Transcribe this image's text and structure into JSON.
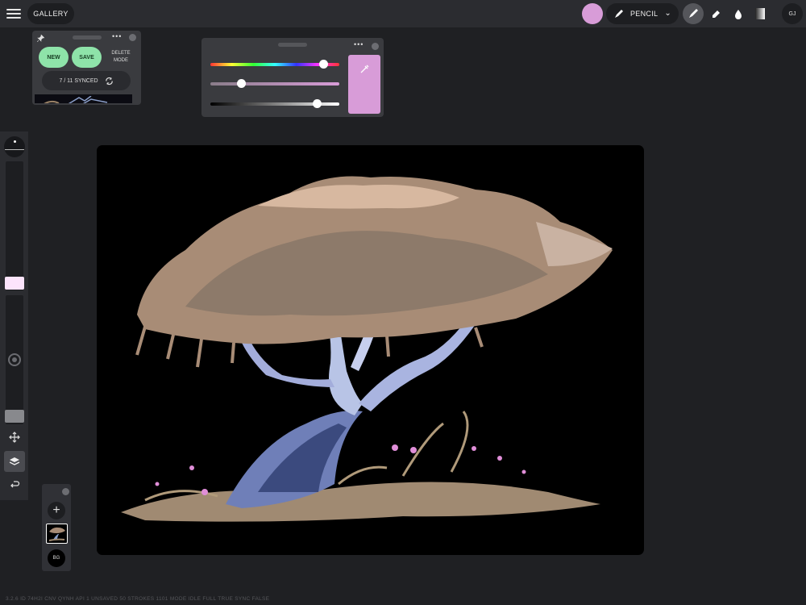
{
  "topbar": {
    "menu_icon": "hamburger-icon",
    "gallery_label": "GALLERY",
    "current_color": "#d89cd8",
    "brush_name": "PENCIL",
    "brush_icon": "pencil-icon",
    "dropdown_icon": "chevron-down-icon",
    "tools": [
      "brush-icon",
      "eraser-icon",
      "smudge-drop-icon",
      "gradient-icon"
    ],
    "active_tool": "brush",
    "user_initials": "GJ"
  },
  "sync_panel": {
    "pin_icon": "pin-icon",
    "new_label": "NEW",
    "save_label": "SAVE",
    "delete_label": "DELETE MODE",
    "synced_text": "7 / 11 SYNCED",
    "sync_icon": "sync-icon"
  },
  "color_panel": {
    "hue": 0.88,
    "saturation": 0.24,
    "brightness": 0.83,
    "preview_color": "#d89cd8",
    "eyedropper_icon": "eyedropper-icon"
  },
  "left_toolbar": {
    "brush_size": 0.0,
    "opacity_swatch": "#fce4fc",
    "tools": [
      "move-icon",
      "layers-icon",
      "undo-icon"
    ]
  },
  "layers": {
    "add_label": "+",
    "background_label": "BG"
  },
  "status_bar": "3.2.6   ID 74H2I  CNV QYNH  API 1  UNSAVED 50  STROKES 1101  MODE IDLE  FULL TRUE  SYNC FALSE"
}
